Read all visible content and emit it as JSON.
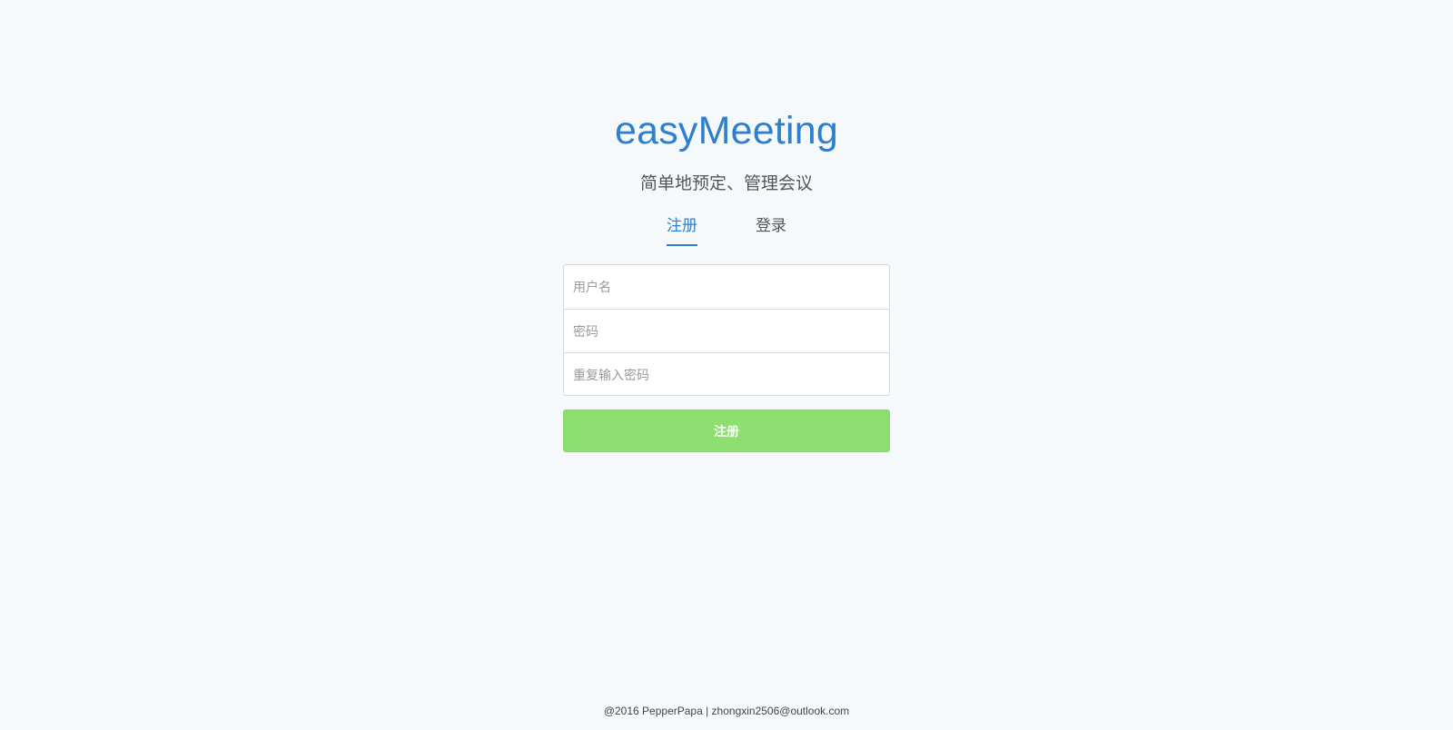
{
  "app": {
    "title": "easyMeeting",
    "subtitle": "简单地预定、管理会议"
  },
  "tabs": [
    {
      "label": "注册",
      "active": true
    },
    {
      "label": "登录",
      "active": false
    }
  ],
  "form": {
    "username": {
      "value": "",
      "placeholder": "用户名"
    },
    "password": {
      "value": "",
      "placeholder": "密码"
    },
    "repeat_password": {
      "value": "",
      "placeholder": "重复输入密码"
    },
    "submit_label": "注册"
  },
  "footer": {
    "text": "@2016 PepperPapa | zhongxin2506@outlook.com"
  },
  "colors": {
    "background": "#f5f9fc",
    "accent": "#2f7fcf",
    "submit_button": "#8ddf6f",
    "border": "#d3d9de"
  }
}
